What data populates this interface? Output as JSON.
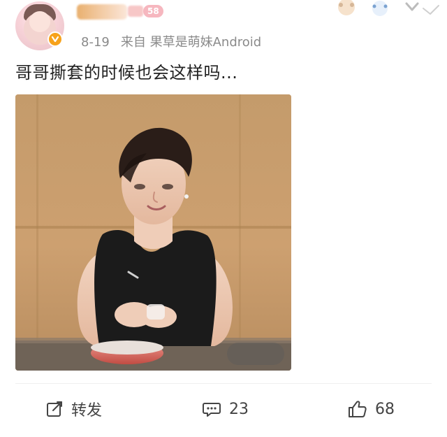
{
  "post": {
    "header": {
      "level_badge": "58",
      "meta": {
        "date": "8-19",
        "source_prefix": "来自",
        "source": "果草是萌妹Android"
      }
    },
    "text": "哥哥撕套的时候也会这样吗...",
    "actions": {
      "repost_label": "转发",
      "comment_count": "23",
      "like_count": "68"
    }
  },
  "colors": {
    "verify_badge": "#f7a21b",
    "meta_text": "#8a8a8a",
    "action_text": "#444444"
  },
  "icons": {
    "verify": "verified-badge-icon",
    "repost": "repost-icon",
    "comment": "comment-icon",
    "like": "thumbs-up-icon"
  }
}
